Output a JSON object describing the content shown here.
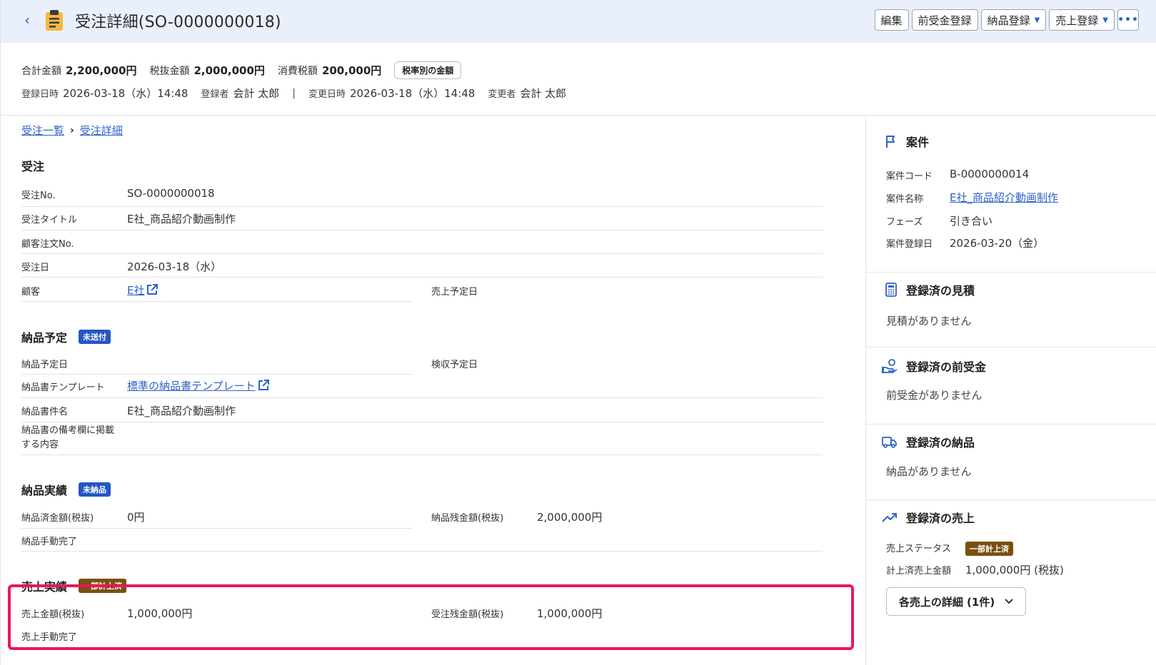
{
  "header": {
    "title": "受注詳細(SO-0000000018)",
    "actions": {
      "edit": "編集",
      "advance": "前受金登録",
      "delivery": "納品登録",
      "sales": "売上登録",
      "more": "•••"
    }
  },
  "summary": {
    "total_label": "合計金額",
    "total_value": "2,200,000円",
    "net_label": "税抜金額",
    "net_value": "2,000,000円",
    "tax_label": "消費税額",
    "tax_value": "200,000円",
    "tax_button": "税率別の金額",
    "created_label": "登録日時",
    "created_value": "2026-03-18（水）14:48",
    "creator_label": "登録者",
    "creator_value": "会計 太郎",
    "separator": "|",
    "updated_label": "変更日時",
    "updated_value": "2026-03-18（水）14:48",
    "updater_label": "変更者",
    "updater_value": "会計 太郎"
  },
  "breadcrumb": {
    "list": "受注一覧",
    "current": "受注詳細"
  },
  "order": {
    "title": "受注",
    "no_label": "受注No.",
    "no_value": "SO-0000000018",
    "title_label": "受注タイトル",
    "title_value": "E社_商品紹介動画制作",
    "customer_order_label": "顧客注文No.",
    "date_label": "受注日",
    "date_value": "2026-03-18（水）",
    "customer_label": "顧客",
    "customer_value": "E社",
    "sales_date_label": "売上予定日"
  },
  "delivery_plan": {
    "title": "納品予定",
    "badge": "未送付",
    "date_label": "納品予定日",
    "inspect_label": "検収予定日",
    "template_label": "納品書テンプレート",
    "template_value": "標準の納品書テンプレート",
    "subject_label": "納品書件名",
    "subject_value": "E社_商品紹介動画制作",
    "remarks_label": "納品書の備考欄に掲載する内容"
  },
  "delivery_result": {
    "title": "納品実績",
    "badge": "未納品",
    "done_label": "納品済金額(税抜)",
    "done_value": "0円",
    "remain_label": "納品残金額(税抜)",
    "remain_value": "2,000,000円",
    "manual_label": "納品手動完了"
  },
  "sales_result": {
    "title": "売上実績",
    "badge": "一部計上済",
    "amount_label": "売上金額(税抜)",
    "amount_value": "1,000,000円",
    "remain_label": "受注残金額(税抜)",
    "remain_value": "1,000,000円",
    "manual_label": "売上手動完了"
  },
  "side": {
    "project": {
      "title": "案件",
      "code_label": "案件コード",
      "code_value": "B-0000000014",
      "name_label": "案件名称",
      "name_value": "E社_商品紹介動画制作",
      "phase_label": "フェーズ",
      "phase_value": "引き合い",
      "date_label": "案件登録日",
      "date_value": "2026-03-20（金）"
    },
    "estimate": {
      "title": "登録済の見積",
      "empty": "見積がありません"
    },
    "advance": {
      "title": "登録済の前受金",
      "empty": "前受金がありません"
    },
    "delivery": {
      "title": "登録済の納品",
      "empty": "納品がありません"
    },
    "sales": {
      "title": "登録済の売上",
      "status_label": "売上ステータス",
      "status_badge": "一部計上済",
      "amount_label": "計上済売上金額",
      "amount_value": "1,000,000円 (税抜)",
      "detail_button": "各売上の詳細 (1件)"
    }
  }
}
